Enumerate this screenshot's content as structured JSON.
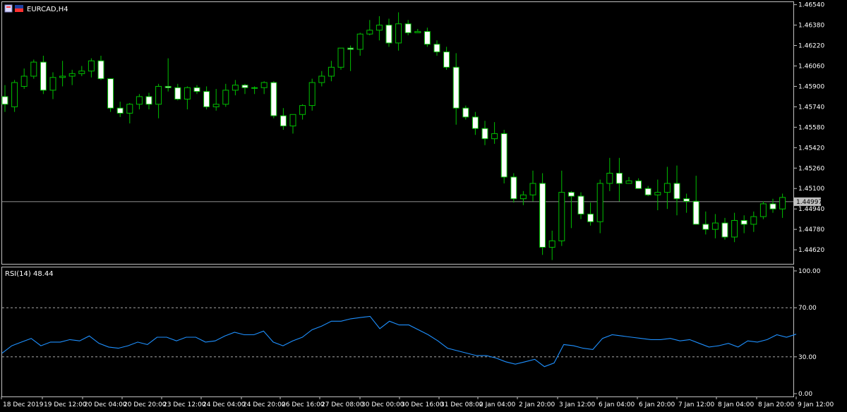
{
  "window": {
    "title": "EURCAD,H4",
    "icon_names": [
      "window-restore-icon",
      "flag-icon"
    ]
  },
  "colors": {
    "background": "#000000",
    "frame": "#c0c0c0",
    "candle_up_body": "#000000",
    "candle_down_body": "#ffffff",
    "candle_wick": "#00c000",
    "rsi_line": "#1e90ff",
    "level_line": "#c0c0c0",
    "bid_line": "#c0c0c0",
    "bid_label_bg": "#c0c0c0",
    "text": "#ffffff"
  },
  "chart_data": [
    {
      "type": "candlestick",
      "title": "EURCAD,H4",
      "ylim": [
        1.4451,
        1.4656
      ],
      "y_ticks": [
        "1.46540",
        "1.46380",
        "1.46220",
        "1.46060",
        "1.45900",
        "1.45740",
        "1.45580",
        "1.45420",
        "1.45260",
        "1.45100",
        "1.44940",
        "1.44780",
        "1.44620"
      ],
      "current_price": "1.44997",
      "current_price_value": 1.44997,
      "x_labels": [
        "18 Dec 2019",
        "19 Dec 12:00",
        "20 Dec 04:00",
        "20 Dec 20:00",
        "23 Dec 12:00",
        "24 Dec 04:00",
        "24 Dec 20:00",
        "26 Dec 16:00",
        "27 Dec 08:00",
        "30 Dec 00:00",
        "30 Dec 16:00",
        "31 Dec 08:00",
        "2 Jan 04:00",
        "2 Jan 20:00",
        "3 Jan 12:00",
        "6 Jan 04:00",
        "6 Jan 20:00",
        "7 Jan 12:00",
        "8 Jan 04:00",
        "8 Jan 20:00",
        "9 Jan 12:00"
      ],
      "ohlc": [
        [
          1.4582,
          1.4591,
          1.457,
          1.4576
        ],
        [
          1.4574,
          1.4595,
          1.457,
          1.4593
        ],
        [
          1.459,
          1.4604,
          1.4588,
          1.4598
        ],
        [
          1.4598,
          1.4611,
          1.4596,
          1.4609
        ],
        [
          1.4609,
          1.4614,
          1.4584,
          1.4587
        ],
        [
          1.4587,
          1.4601,
          1.458,
          1.4597
        ],
        [
          1.4597,
          1.461,
          1.459,
          1.4598
        ],
        [
          1.4598,
          1.4603,
          1.4591,
          1.46
        ],
        [
          1.46,
          1.4606,
          1.4598,
          1.4602
        ],
        [
          1.4602,
          1.4612,
          1.4597,
          1.461
        ],
        [
          1.461,
          1.4614,
          1.4595,
          1.4596
        ],
        [
          1.4596,
          1.4596,
          1.457,
          1.4573
        ],
        [
          1.4573,
          1.4578,
          1.4566,
          1.4569
        ],
        [
          1.4569,
          1.4577,
          1.4561,
          1.4576
        ],
        [
          1.4576,
          1.4584,
          1.4572,
          1.4582
        ],
        [
          1.4582,
          1.4585,
          1.4572,
          1.4576
        ],
        [
          1.4576,
          1.4592,
          1.4565,
          1.459
        ],
        [
          1.459,
          1.4612,
          1.4586,
          1.4589
        ],
        [
          1.4589,
          1.4592,
          1.4579,
          1.458
        ],
        [
          1.458,
          1.459,
          1.4572,
          1.4589
        ],
        [
          1.4589,
          1.4591,
          1.4584,
          1.4586
        ],
        [
          1.4586,
          1.459,
          1.4572,
          1.4574
        ],
        [
          1.4574,
          1.4588,
          1.4571,
          1.4576
        ],
        [
          1.4576,
          1.4592,
          1.4574,
          1.4587
        ],
        [
          1.4587,
          1.4595,
          1.4583,
          1.4591
        ],
        [
          1.4591,
          1.4592,
          1.4584,
          1.4589
        ],
        [
          1.4589,
          1.459,
          1.4584,
          1.4589
        ],
        [
          1.4589,
          1.4594,
          1.4584,
          1.4593
        ],
        [
          1.4593,
          1.4594,
          1.4565,
          1.4567
        ],
        [
          1.4567,
          1.4573,
          1.4556,
          1.4559
        ],
        [
          1.4559,
          1.4568,
          1.4553,
          1.4568
        ],
        [
          1.4568,
          1.4576,
          1.4564,
          1.4575
        ],
        [
          1.4575,
          1.4596,
          1.4571,
          1.4593
        ],
        [
          1.4593,
          1.4602,
          1.459,
          1.4598
        ],
        [
          1.4598,
          1.461,
          1.4594,
          1.4605
        ],
        [
          1.4605,
          1.462,
          1.4603,
          1.462
        ],
        [
          1.462,
          1.4622,
          1.4602,
          1.4619
        ],
        [
          1.4619,
          1.4632,
          1.4614,
          1.4631
        ],
        [
          1.4631,
          1.4642,
          1.463,
          1.4634
        ],
        [
          1.4634,
          1.4645,
          1.4626,
          1.4638
        ],
        [
          1.4638,
          1.4643,
          1.4621,
          1.4624
        ],
        [
          1.4624,
          1.4648,
          1.4618,
          1.4639
        ],
        [
          1.4639,
          1.4642,
          1.463,
          1.4632
        ],
        [
          1.4632,
          1.4635,
          1.4632,
          1.4633
        ],
        [
          1.4633,
          1.4636,
          1.4621,
          1.4623
        ],
        [
          1.4623,
          1.4626,
          1.4614,
          1.4617
        ],
        [
          1.4617,
          1.4621,
          1.4603,
          1.4605
        ],
        [
          1.4605,
          1.4616,
          1.456,
          1.4573
        ],
        [
          1.4573,
          1.4575,
          1.4564,
          1.4566
        ],
        [
          1.4566,
          1.457,
          1.4552,
          1.4557
        ],
        [
          1.4557,
          1.4563,
          1.4544,
          1.4549
        ],
        [
          1.4549,
          1.4562,
          1.4545,
          1.4553
        ],
        [
          1.4553,
          1.4556,
          1.4514,
          1.4519
        ],
        [
          1.4519,
          1.4522,
          1.4499,
          1.4502
        ],
        [
          1.4502,
          1.4508,
          1.4497,
          1.4505
        ],
        [
          1.4505,
          1.4524,
          1.45,
          1.4514
        ],
        [
          1.4514,
          1.4522,
          1.4458,
          1.4464
        ],
        [
          1.4464,
          1.4477,
          1.4454,
          1.4469
        ],
        [
          1.4469,
          1.4524,
          1.4465,
          1.4507
        ],
        [
          1.4507,
          1.4508,
          1.4479,
          1.4504
        ],
        [
          1.4504,
          1.4507,
          1.4486,
          1.449
        ],
        [
          1.449,
          1.4499,
          1.4481,
          1.4484
        ],
        [
          1.4484,
          1.4517,
          1.4475,
          1.4514
        ],
        [
          1.4514,
          1.4534,
          1.4508,
          1.4522
        ],
        [
          1.4522,
          1.4534,
          1.45,
          1.4514
        ],
        [
          1.4514,
          1.4519,
          1.4514,
          1.4516
        ],
        [
          1.4516,
          1.4518,
          1.451,
          1.451
        ],
        [
          1.451,
          1.4512,
          1.4504,
          1.4505
        ],
        [
          1.4505,
          1.4517,
          1.4493,
          1.4507
        ],
        [
          1.4507,
          1.4527,
          1.4494,
          1.4514
        ],
        [
          1.4514,
          1.4528,
          1.4489,
          1.4502
        ],
        [
          1.4502,
          1.4506,
          1.4491,
          1.45
        ],
        [
          1.45,
          1.452,
          1.4496,
          1.4482
        ],
        [
          1.4482,
          1.4492,
          1.4474,
          1.4478
        ],
        [
          1.4478,
          1.449,
          1.4471,
          1.4483
        ],
        [
          1.4483,
          1.4487,
          1.447,
          1.4472
        ],
        [
          1.4472,
          1.4491,
          1.4468,
          1.4485
        ],
        [
          1.4485,
          1.4489,
          1.4475,
          1.4482
        ],
        [
          1.4482,
          1.4492,
          1.4476,
          1.4488
        ],
        [
          1.4488,
          1.45,
          1.4486,
          1.4498
        ],
        [
          1.4498,
          1.4502,
          1.4491,
          1.4494
        ],
        [
          1.4494,
          1.4506,
          1.4487,
          1.4503
        ]
      ]
    },
    {
      "type": "line",
      "title": "RSI(14) 48.44",
      "ylim": [
        0,
        100
      ],
      "y_ticks": [
        "100.00",
        "70.00",
        "30.00",
        "0.00"
      ],
      "levels": [
        70,
        30
      ],
      "values": [
        33,
        39,
        42,
        45,
        39,
        42,
        42,
        44,
        43,
        47,
        41,
        38,
        37,
        39,
        42,
        40,
        46,
        46,
        43,
        46,
        46,
        42,
        43,
        47,
        50,
        48,
        48,
        51,
        42,
        39,
        43,
        46,
        52,
        55,
        59,
        59,
        61,
        62,
        63,
        53,
        59,
        56,
        56,
        52,
        48,
        43,
        37,
        35,
        33,
        31,
        31,
        29,
        26,
        24,
        26,
        28,
        22,
        25,
        40,
        39,
        37,
        36,
        45,
        48,
        47,
        46,
        45,
        44,
        44,
        45,
        43,
        44,
        41,
        38,
        39,
        41,
        38,
        43,
        42,
        44,
        48,
        46,
        48.44
      ]
    }
  ]
}
